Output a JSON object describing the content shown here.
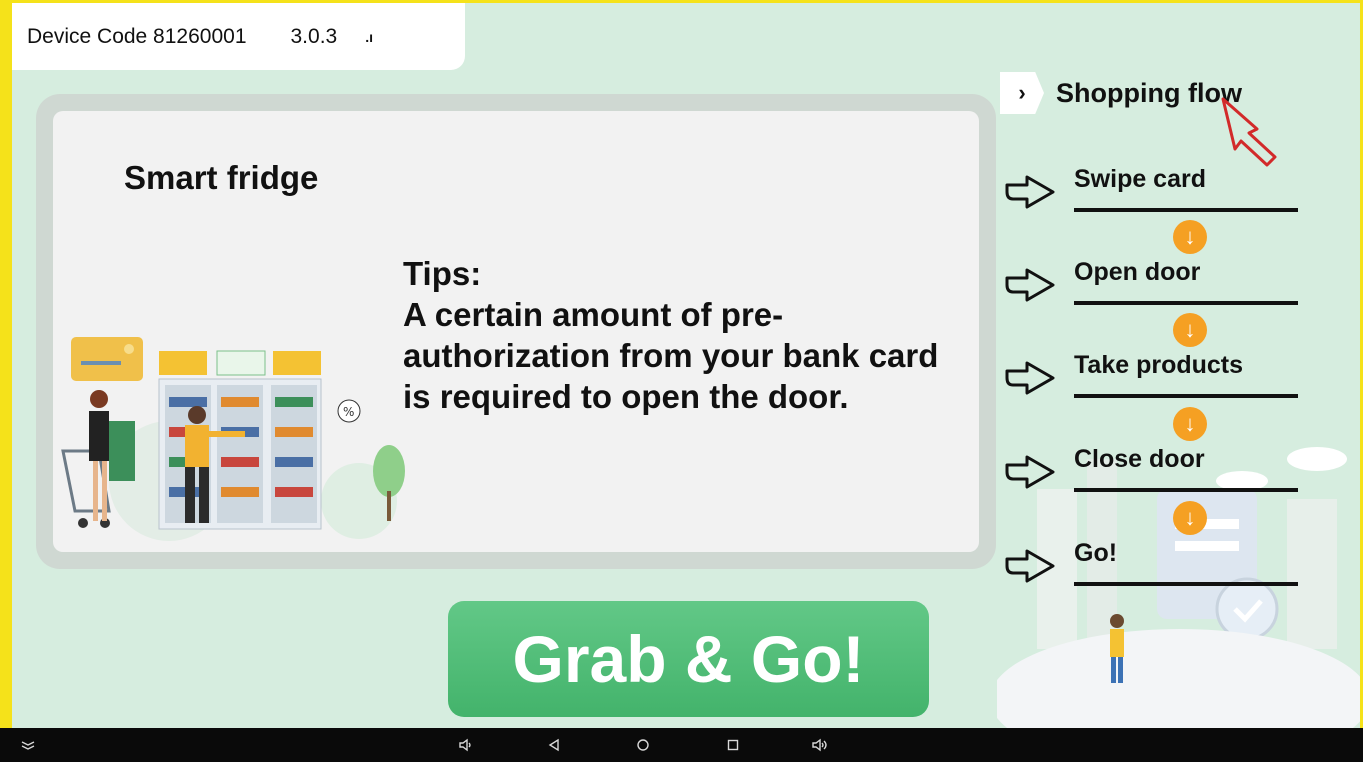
{
  "status_bar": {
    "device_code": "Device Code 81260001",
    "version": "3.0.3",
    "signal": ".ı"
  },
  "main_card": {
    "title": "Smart fridge",
    "tips_heading": "Tips:",
    "tips_body": " A certain amount of pre-authorization from your bank card is required to open the door."
  },
  "grab_button": {
    "label": "Grab & Go!"
  },
  "flow": {
    "title": "Shopping flow",
    "steps": [
      {
        "label": "Swipe card"
      },
      {
        "label": "Open door"
      },
      {
        "label": "Take products"
      },
      {
        "label": "Close door"
      },
      {
        "label": "Go!"
      }
    ]
  },
  "nav_bar": {
    "icons": [
      "collapse-icon",
      "volume-down-icon",
      "back-icon",
      "home-icon",
      "recents-icon",
      "volume-up-icon"
    ]
  },
  "colors": {
    "background": "#d6eddf",
    "frame": "#f5e21a",
    "button_green": "#4cbb74",
    "step_arrow_orange": "#f5a023"
  }
}
